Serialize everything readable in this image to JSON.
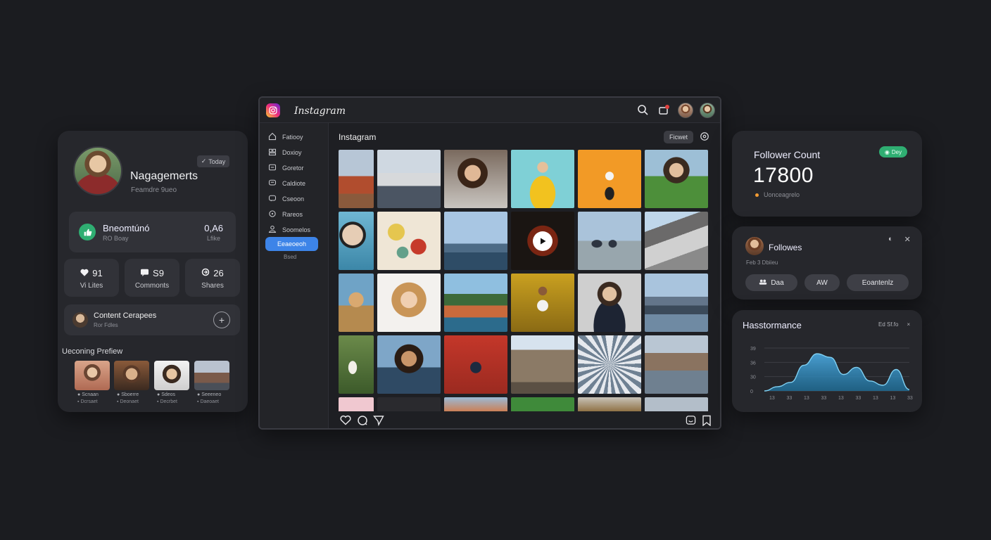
{
  "left_panel": {
    "badge": "Today",
    "name": "Nagagemerts",
    "subtitle": "Feamdre 9ueo",
    "engagement": {
      "title": "Bneomtúnó",
      "sub": "RO Boay",
      "value": "0,A6",
      "value_sub": "Lfike"
    },
    "stats": [
      {
        "icon": "heart-icon",
        "value": "91",
        "label": "Vi Lites"
      },
      {
        "icon": "comment-icon",
        "value": "S9",
        "label": "Commonts"
      },
      {
        "icon": "share-icon",
        "value": "26",
        "label": "Shares"
      }
    ],
    "content_card": {
      "title": "Content Cerapees",
      "sub": "Ror Fdles"
    },
    "upcoming": {
      "title": "Ueconing Prefiew",
      "items": [
        {
          "l1": "Scnaan",
          "l2": "Dcrsaet"
        },
        {
          "l1": "Sboerre",
          "l2": "Deonaet"
        },
        {
          "l1": "Sdeos",
          "l2": "Decrbet"
        },
        {
          "l1": "Seeeneo",
          "l2": "Daeoaet"
        }
      ]
    }
  },
  "ig": {
    "app_title": "Instagram",
    "main_title": "Instagram",
    "follow_label": "Ficwet",
    "sidebar": [
      {
        "icon": "home-icon",
        "label": "Fatiooy"
      },
      {
        "icon": "people-icon",
        "label": "Doxioy"
      },
      {
        "icon": "inbox-icon",
        "label": "Goretor"
      },
      {
        "icon": "message-icon",
        "label": "Caldiote"
      },
      {
        "icon": "message-icon",
        "label": "Cseoon"
      },
      {
        "icon": "explore-icon",
        "label": "Rareos"
      },
      {
        "icon": "user-icon",
        "label": "Soomelos"
      }
    ],
    "sidebar_active": "Eeaeoeoh",
    "sidebar_sub": "Bsed"
  },
  "follower_count": {
    "title": "Follower Count",
    "value": "17800",
    "badge": "Dey",
    "sub": "Uonceagrelo"
  },
  "followers": {
    "title": "Followes",
    "sub": "Feb 3 Dbiieu",
    "buttons": [
      {
        "icon": "group-icon",
        "label": "Daa"
      },
      {
        "icon": "",
        "label": "AW"
      },
      {
        "icon": "",
        "label": "Eoantenlz"
      }
    ]
  },
  "performance": {
    "title": "Hasstormance",
    "controls": "Ed Sf.fo",
    "close": "×"
  },
  "chart_data": {
    "type": "area",
    "title": "Hasstormance",
    "y_tick_labels": [
      "39",
      "36",
      "30",
      "0"
    ],
    "x_tick_labels": [
      "13",
      "33",
      "13",
      "33",
      "13",
      "33",
      "13",
      "13",
      "33"
    ],
    "series": [
      {
        "values": [
          0,
          6,
          12,
          36,
          52,
          47,
          23,
          33,
          14,
          8,
          30,
          2
        ]
      }
    ],
    "color": "#4aa3d8",
    "grid": true
  }
}
